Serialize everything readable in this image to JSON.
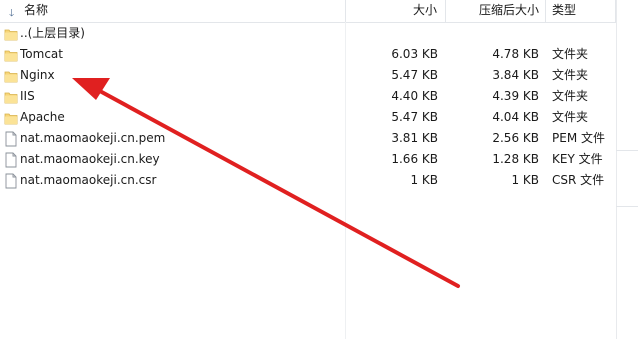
{
  "columns": {
    "name": "名称",
    "size": "大小",
    "compressed": "压缩后大小",
    "type": "类型"
  },
  "files": [
    {
      "name": "..(上层目录)",
      "size": "",
      "compressed": "",
      "type": "",
      "icon": "folder-icon"
    },
    {
      "name": "Tomcat",
      "size": "6.03 KB",
      "compressed": "4.78 KB",
      "type": "文件夹",
      "icon": "folder-icon"
    },
    {
      "name": "Nginx",
      "size": "5.47 KB",
      "compressed": "3.84 KB",
      "type": "文件夹",
      "icon": "folder-icon"
    },
    {
      "name": "IIS",
      "size": "4.40 KB",
      "compressed": "4.39 KB",
      "type": "文件夹",
      "icon": "folder-icon"
    },
    {
      "name": "Apache",
      "size": "5.47 KB",
      "compressed": "4.04 KB",
      "type": "文件夹",
      "icon": "folder-icon"
    },
    {
      "name": "nat.maomaokeji.cn.pem",
      "size": "3.81 KB",
      "compressed": "2.56 KB",
      "type": "PEM 文件",
      "icon": "file-icon"
    },
    {
      "name": "nat.maomaokeji.cn.key",
      "size": "1.66 KB",
      "compressed": "1.28 KB",
      "type": "KEY 文件",
      "icon": "file-icon"
    },
    {
      "name": "nat.maomaokeji.cn.csr",
      "size": "1 KB",
      "compressed": "1 KB",
      "type": "CSR 文件",
      "icon": "file-icon"
    }
  ],
  "annotation": {
    "color": "#e02020",
    "icon": "red-arrow-annotation"
  }
}
